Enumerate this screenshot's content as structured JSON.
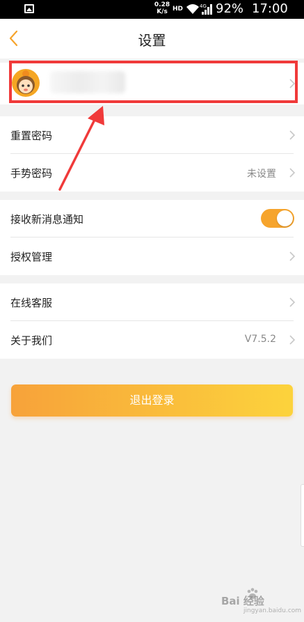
{
  "status_bar": {
    "speed_value": "0.28",
    "speed_unit": "K/s",
    "hd": "HD",
    "network": "4G",
    "battery": "92%",
    "time": "17:00"
  },
  "header": {
    "title": "设置"
  },
  "settings": {
    "group1": [
      {
        "label": "重置密码",
        "value": ""
      },
      {
        "label": "手势密码",
        "value": "未设置"
      }
    ],
    "group2": [
      {
        "label": "接收新消息通知",
        "toggle": true
      },
      {
        "label": "授权管理",
        "value": ""
      }
    ],
    "group3": [
      {
        "label": "在线客服",
        "value": ""
      },
      {
        "label": "关于我们",
        "value": "V7.5.2"
      }
    ]
  },
  "logout_label": "退出登录",
  "watermark": {
    "text": "Bai  经验",
    "sub": "jingyan.baidu.com"
  },
  "colors": {
    "accent": "#f6a42c",
    "highlight": "#f03a3a",
    "logout_gradient_start": "#f7a23a",
    "logout_gradient_end": "#fcd33c"
  }
}
